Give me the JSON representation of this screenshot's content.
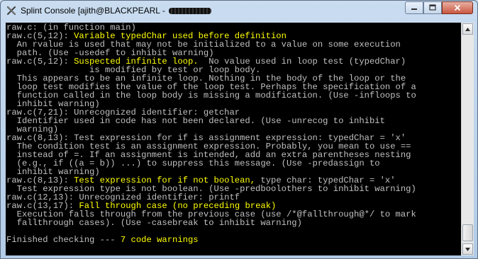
{
  "window": {
    "title": "Splint Console [ajith@BLACKPEARL - ",
    "icon": "terminal-icon",
    "controls": {
      "minimize": "minimize-icon",
      "maximize": "maximize-icon",
      "close": "close-icon"
    }
  },
  "console": {
    "lines": [
      {
        "segments": [
          {
            "text": "raw.c: (in function main)"
          }
        ]
      },
      {
        "segments": [
          {
            "text": "raw.c(5,12): "
          },
          {
            "text": "Variable typedChar used before definition",
            "color": "yellow"
          }
        ]
      },
      {
        "segments": [
          {
            "text": "  An rvalue is used that may not be initialized to a value on some execution"
          }
        ]
      },
      {
        "segments": [
          {
            "text": "  path. (Use -usedef to inhibit warning)"
          }
        ]
      },
      {
        "segments": [
          {
            "text": "raw.c(5,12): "
          },
          {
            "text": "Suspected infinite loop.",
            "color": "yellow"
          },
          {
            "text": "  No value used in loop test (typedChar)"
          }
        ]
      },
      {
        "segments": [
          {
            "text": "                is modified by test or loop body."
          }
        ]
      },
      {
        "segments": [
          {
            "text": "  This appears to be an infinite loop. Nothing in the body of the loop or the"
          }
        ]
      },
      {
        "segments": [
          {
            "text": "  loop test modifies the value of the loop test. Perhaps the specification of a"
          }
        ]
      },
      {
        "segments": [
          {
            "text": "  function called in the loop body is missing a modification. (Use -infloops to"
          }
        ]
      },
      {
        "segments": [
          {
            "text": "  inhibit warning)"
          }
        ]
      },
      {
        "segments": [
          {
            "text": "raw.c(7,21): Unrecognized identifier: getchar"
          }
        ]
      },
      {
        "segments": [
          {
            "text": "  Identifier used in code has not been declared. (Use -unrecog to inhibit"
          }
        ]
      },
      {
        "segments": [
          {
            "text": "  warning)"
          }
        ]
      },
      {
        "segments": [
          {
            "text": "raw.c(8,13): Test expression for if is assignment expression: typedChar = 'x'"
          }
        ]
      },
      {
        "segments": [
          {
            "text": "  The condition test is an assignment expression. Probably, you mean to use =="
          }
        ]
      },
      {
        "segments": [
          {
            "text": "  instead of =. If an assignment is intended, add an extra parentheses nesting"
          }
        ]
      },
      {
        "segments": [
          {
            "text": "  (e.g., if ((a = b)) ...) to suppress this message. (Use -predassign to"
          }
        ]
      },
      {
        "segments": [
          {
            "text": "  inhibit warning)"
          }
        ]
      },
      {
        "segments": [
          {
            "text": "raw.c(8,13): "
          },
          {
            "text": "Test expression for if not boolean,",
            "color": "yellow"
          },
          {
            "text": " type char: typedChar = 'x'"
          }
        ]
      },
      {
        "segments": [
          {
            "text": "  Test expression type is not boolean. (Use -predboolothers to inhibit warning)"
          }
        ]
      },
      {
        "segments": [
          {
            "text": "raw.c(12,13): Unrecognized identifier: printf"
          }
        ]
      },
      {
        "segments": [
          {
            "text": "raw.c(13,17): "
          },
          {
            "text": "Fall through case (no preceding break)",
            "color": "yellow"
          }
        ]
      },
      {
        "segments": [
          {
            "text": "  Execution falls through from the previous case (use /*@fallthrough@*/ to mark"
          }
        ]
      },
      {
        "segments": [
          {
            "text": "  fallthrough cases). (Use -casebreak to inhibit warning)"
          }
        ]
      },
      {
        "segments": [
          {
            "text": ""
          }
        ]
      },
      {
        "segments": [
          {
            "text": "Finished checking --- "
          },
          {
            "text": "7 code warnings",
            "color": "yellow"
          }
        ]
      }
    ]
  },
  "scrollbar": {
    "up": "scroll-up-arrow-icon",
    "down": "scroll-down-arrow-icon",
    "position": 0.96
  }
}
